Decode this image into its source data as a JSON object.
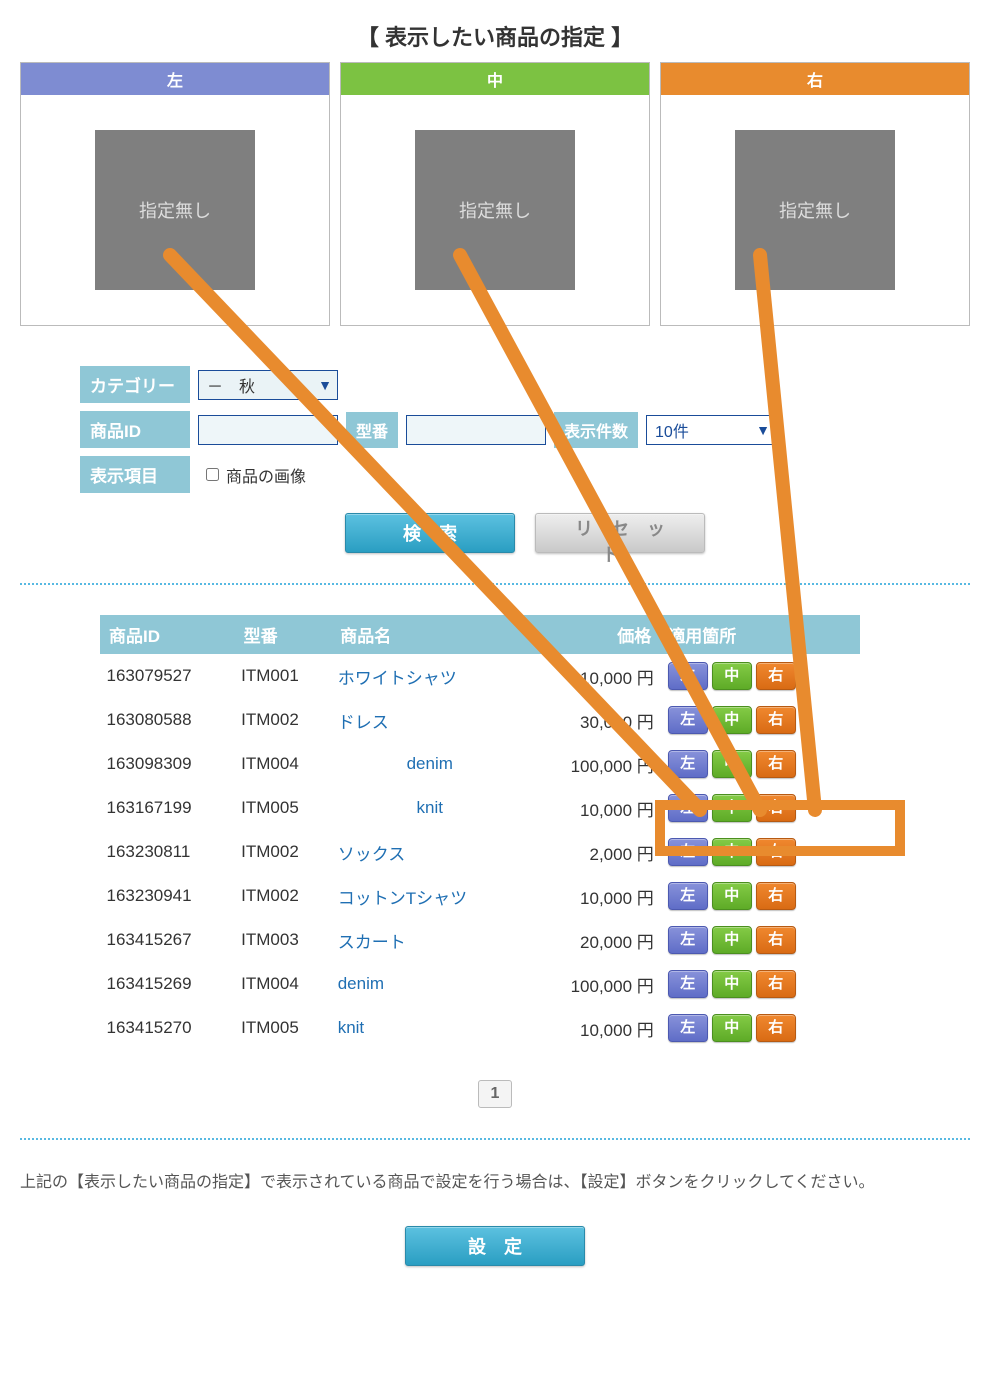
{
  "title": "【 表示したい商品の指定 】",
  "slots": {
    "left": {
      "label": "左",
      "thumb": "指定無し"
    },
    "center": {
      "label": "中",
      "thumb": "指定無し"
    },
    "right": {
      "label": "右",
      "thumb": "指定無し"
    }
  },
  "filter": {
    "category_label": "カテゴリー",
    "category_value": "－　秋",
    "product_id_label": "商品ID",
    "product_id_value": "",
    "model_label": "型番",
    "model_value": "",
    "perpage_label": "表示件数",
    "perpage_value": "10件",
    "fields_label": "表示項目",
    "show_image_label": "商品の画像"
  },
  "buttons": {
    "search": "検索",
    "reset": "リセット",
    "set": "設定"
  },
  "table": {
    "headers": {
      "id": "商品ID",
      "model": "型番",
      "name": "商品名",
      "price": "価格",
      "apply": "適用箇所"
    },
    "rows": [
      {
        "id": "163079527",
        "model": "ITM001",
        "name": "ホワイトシャツ",
        "name_align": "left",
        "price": "10,000 円"
      },
      {
        "id": "163080588",
        "model": "ITM002",
        "name": "ドレス",
        "name_align": "left",
        "price": "30,000 円"
      },
      {
        "id": "163098309",
        "model": "ITM004",
        "name": "denim",
        "name_align": "center",
        "price": "100,000 円"
      },
      {
        "id": "163167199",
        "model": "ITM005",
        "name": "knit",
        "name_align": "center",
        "price": "10,000 円"
      },
      {
        "id": "163230811",
        "model": "ITM002",
        "name": "ソックス",
        "name_align": "left",
        "price": "2,000 円"
      },
      {
        "id": "163230941",
        "model": "ITM002",
        "name": "コットンTシャツ",
        "name_align": "left",
        "price": "10,000 円"
      },
      {
        "id": "163415267",
        "model": "ITM003",
        "name": "スカート",
        "name_align": "left",
        "price": "20,000 円"
      },
      {
        "id": "163415269",
        "model": "ITM004",
        "name": "denim",
        "name_align": "left",
        "price": "100,000 円"
      },
      {
        "id": "163415270",
        "model": "ITM005",
        "name": "knit",
        "name_align": "left",
        "price": "10,000 円"
      }
    ]
  },
  "pill_labels": {
    "left": "左",
    "center": "中",
    "right": "右"
  },
  "pager": {
    "current": "1"
  },
  "instruction": "上記の【表示したい商品の指定】で表示されている商品で設定を行う場合は、【設定】ボタンをクリックしてください。",
  "annotation": {
    "highlight_row_index": 4,
    "color": "#e88b2e"
  }
}
